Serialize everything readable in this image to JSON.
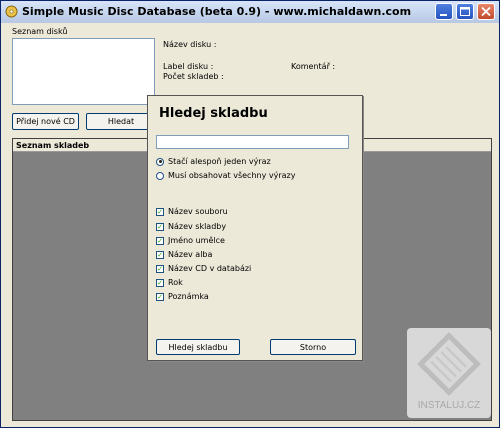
{
  "window": {
    "title": "Simple Music Disc Database (beta 0.9) - www.michaldawn.com"
  },
  "left": {
    "disk_list_label": "Seznam disků",
    "add_cd_button": "Přidej nové CD",
    "search_button": "Hledat"
  },
  "info": {
    "disk_name_label": "Název disku :",
    "disk_label_label": "Label disku :",
    "track_count_label": "Počet skladeb :",
    "comment_label": "Komentář :"
  },
  "tracks": {
    "header": "Seznam skladeb"
  },
  "dialog": {
    "title": "Hledej skladbu",
    "search_value": "",
    "radio_any": "Stačí alespoň jeden výraz",
    "radio_all": "Musí obsahovat všechny výrazy",
    "fields": [
      {
        "label": "Název souboru",
        "checked": true
      },
      {
        "label": "Název skladby",
        "checked": true
      },
      {
        "label": "Jméno umělce",
        "checked": true
      },
      {
        "label": "Název alba",
        "checked": true
      },
      {
        "label": "Název CD v databázi",
        "checked": true
      },
      {
        "label": "Rok",
        "checked": true
      },
      {
        "label": "Poznámka",
        "checked": true
      }
    ],
    "search_button": "Hledej skladbu",
    "cancel_button": "Storno"
  },
  "watermark": {
    "text": "INSTALUJ.CZ"
  }
}
